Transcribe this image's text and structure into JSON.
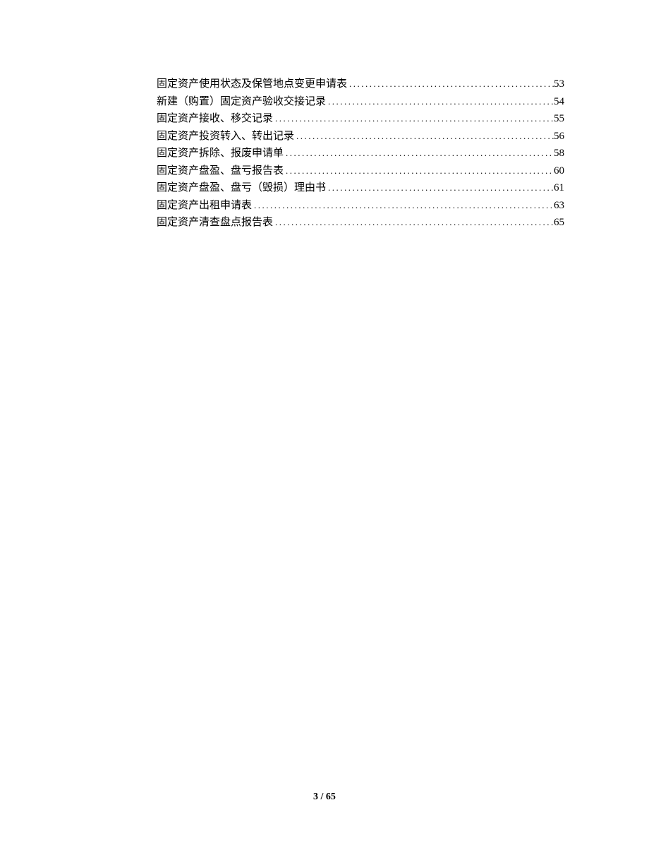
{
  "toc": {
    "entries": [
      {
        "title": "固定资产使用状态及保管地点变更申请表",
        "page": "53"
      },
      {
        "title": "新建（购置）固定资产验收交接记录",
        "page": "54"
      },
      {
        "title": "固定资产接收、移交记录",
        "page": "55"
      },
      {
        "title": "固定资产投资转入、转出记录",
        "page": "56"
      },
      {
        "title": "固定资产拆除、报废申请单",
        "page": "58"
      },
      {
        "title": "固定资产盘盈、盘亏报告表",
        "page": "60"
      },
      {
        "title": "固定资产盘盈、盘亏（毁损）理由书",
        "page": "61"
      },
      {
        "title": "固定资产出租申请表",
        "page": "63"
      },
      {
        "title": "固定资产清查盘点报告表",
        "page": "65"
      }
    ]
  },
  "footer": {
    "page_indicator": "3 / 65"
  }
}
